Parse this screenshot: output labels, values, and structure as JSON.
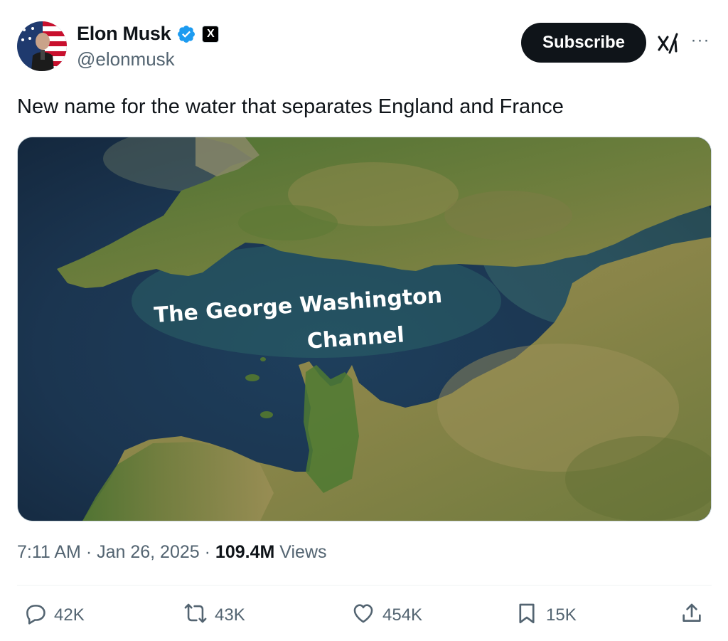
{
  "author": {
    "display_name": "Elon Musk",
    "handle": "@elonmusk",
    "verified_icon": "verified-badge-icon",
    "affiliation_icon": "x-logo-icon",
    "affiliation_glyph": "X"
  },
  "header": {
    "subscribe_label": "Subscribe",
    "grok_icon": "grok-icon",
    "more_icon": "more-options-icon",
    "more_glyph": "···"
  },
  "tweet": {
    "text": "New name for the water that separates England and France",
    "media": {
      "label_line1": "The George Washington",
      "label_line2": "Channel"
    },
    "time": "7:11 AM",
    "date": "Jan 26, 2025",
    "separator": "·",
    "views_count": "109.4M",
    "views_label": "Views"
  },
  "actions": {
    "replies": "42K",
    "reposts": "43K",
    "likes": "454K",
    "bookmarks": "15K"
  },
  "colors": {
    "text_primary": "#0f1419",
    "text_secondary": "#536471",
    "verified_blue": "#1d9bf0",
    "button_dark": "#0f1419"
  }
}
